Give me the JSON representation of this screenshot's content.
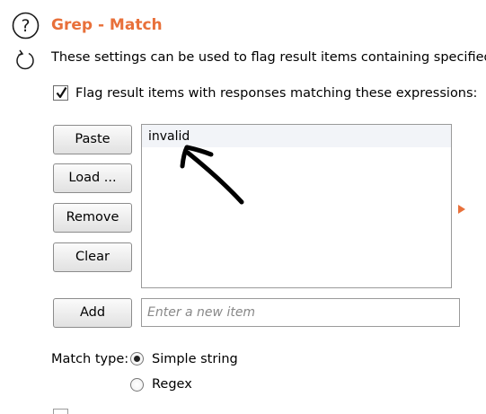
{
  "section": {
    "title": "Grep - Match",
    "description": "These settings can be used to flag result items containing specified exp",
    "help_icon": "help-circle-icon",
    "refresh_icon": "refresh-icon"
  },
  "flag_option": {
    "label": "Flag result items with responses matching these expressions:",
    "checked": true
  },
  "buttons": {
    "paste": "Paste",
    "load": "Load ...",
    "remove": "Remove",
    "clear": "Clear",
    "add": "Add"
  },
  "expressions": [
    "invalid"
  ],
  "add_input": {
    "value": "",
    "placeholder": "Enter a new item"
  },
  "match_type": {
    "label": "Match type:",
    "options": [
      {
        "label": "Simple string",
        "selected": true
      },
      {
        "label": "Regex",
        "selected": false
      }
    ]
  },
  "colors": {
    "accent": "#e8703a",
    "list_item_bg": "#f2f4f8"
  }
}
